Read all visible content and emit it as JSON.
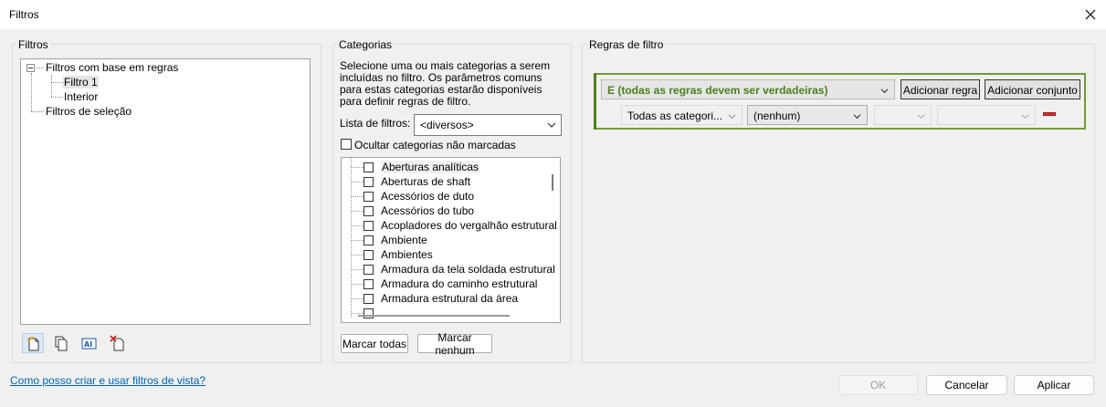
{
  "window": {
    "title": "Filtros"
  },
  "filtros": {
    "group_title": "Filtros",
    "tree": {
      "root_rules": "Filtros com base em regras",
      "child_1": "Filtro 1",
      "child_2": "Interior",
      "root_selection": "Filtros de seleção"
    }
  },
  "categorias": {
    "group_title": "Categorias",
    "description": "Selecione uma ou mais categorias a serem incluídas no filtro. Os parâmetros comuns para estas categorias estarão disponíveis para definir regras de filtro.",
    "filter_list_label": "Lista de filtros:",
    "filter_list_value": "<diversos>",
    "hide_unchecked_label": "Ocultar categorias não marcadas",
    "items": [
      "Aberturas analíticas",
      "Aberturas de shaft",
      "Acessórios de duto",
      "Acessórios do tubo",
      "Acopladores do vergalhão estrutural",
      "Ambiente",
      "Ambientes",
      "Armadura da tela soldada estrutural",
      "Armadura do caminho estrutural",
      "Armadura estrutural da área"
    ],
    "check_all": "Marcar todas",
    "check_none": "Marcar nenhum"
  },
  "regras": {
    "group_title": "Regras de filtro",
    "and_condition": "E (todas as regras devem ser verdadeiras)",
    "add_rule": "Adicionar regra",
    "add_set": "Adicionar conjunto",
    "rule_category": "Todas as categori...",
    "rule_parameter": "(nenhum)"
  },
  "footer": {
    "help_link": "Como posso criar e usar filtros de vista?",
    "ok": "OK",
    "cancel": "Cancelar",
    "apply": "Aplicar"
  }
}
